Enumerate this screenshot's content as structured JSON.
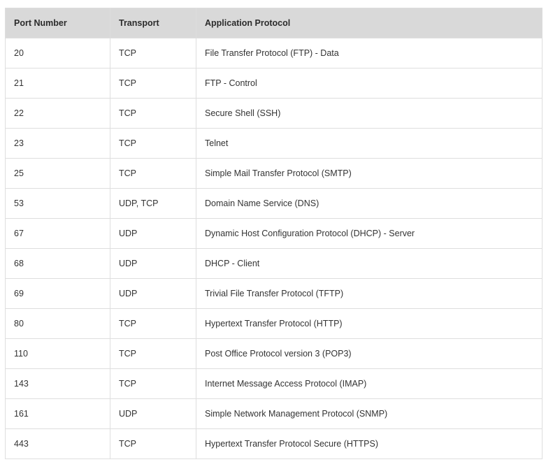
{
  "table": {
    "headers": [
      "Port Number",
      "Transport",
      "Application Protocol"
    ],
    "rows": [
      [
        "20",
        "TCP",
        "File Transfer Protocol (FTP) - Data"
      ],
      [
        "21",
        "TCP",
        "FTP - Control"
      ],
      [
        "22",
        "TCP",
        "Secure Shell (SSH)"
      ],
      [
        "23",
        "TCP",
        "Telnet"
      ],
      [
        "25",
        "TCP",
        "Simple Mail Transfer Protocol (SMTP)"
      ],
      [
        "53",
        "UDP, TCP",
        "Domain Name Service (DNS)"
      ],
      [
        "67",
        "UDP",
        "Dynamic Host Configuration Protocol (DHCP) - Server"
      ],
      [
        "68",
        "UDP",
        "DHCP - Client"
      ],
      [
        "69",
        "UDP",
        "Trivial File Transfer Protocol (TFTP)"
      ],
      [
        "80",
        "TCP",
        "Hypertext Transfer Protocol (HTTP)"
      ],
      [
        "110",
        "TCP",
        "Post Office Protocol version 3 (POP3)"
      ],
      [
        "143",
        "TCP",
        "Internet Message Access Protocol (IMAP)"
      ],
      [
        "161",
        "UDP",
        "Simple Network Management Protocol (SNMP)"
      ],
      [
        "443",
        "TCP",
        "Hypertext Transfer Protocol Secure (HTTPS)"
      ]
    ]
  }
}
